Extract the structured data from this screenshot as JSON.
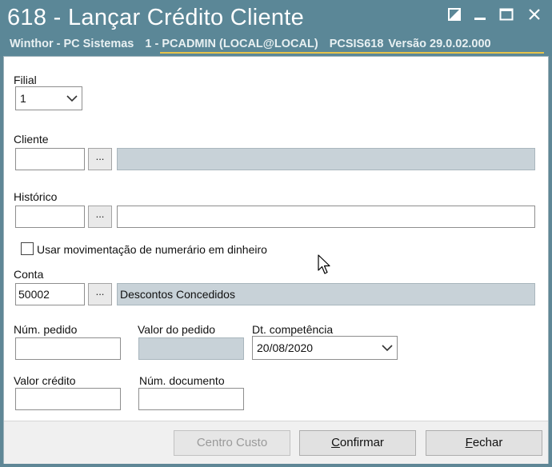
{
  "window": {
    "title": "618 - Lançar Crédito Cliente",
    "company": "Winthor - PC Sistemas",
    "instance": "1 - PCADMIN (LOCAL@LOCAL)",
    "program": "PCSIS618",
    "version": "Versão  29.0.02.000"
  },
  "form": {
    "filial_label": "Filial",
    "filial_value": "1",
    "cliente_label": "Cliente",
    "cliente_code": "",
    "cliente_name": "",
    "historico_label": "Histórico",
    "historico_code": "",
    "historico_desc": "",
    "checkbox_label": "Usar movimentação de numerário em dinheiro",
    "conta_label": "Conta",
    "conta_code": "50002",
    "conta_name": "Descontos Concedidos",
    "num_pedido_label": "Núm. pedido",
    "num_pedido_value": "",
    "valor_pedido_label": "Valor do pedido",
    "valor_pedido_value": "",
    "dt_competencia_label": "Dt. competência",
    "dt_competencia_value": "20/08/2020",
    "valor_credito_label": "Valor crédito",
    "valor_credito_value": "",
    "num_documento_label": "Núm. documento",
    "num_documento_value": "",
    "ellipsis": "..."
  },
  "footer": {
    "centro_custo": "Centro Custo",
    "confirmar_first": "C",
    "confirmar_rest": "onfirmar",
    "fechar_first": "F",
    "fechar_rest": "echar"
  },
  "icons": [
    "minimize-icon",
    "maximize-icon",
    "close-icon",
    "chevron-down-icon",
    "mouse-pointer-icon"
  ]
}
